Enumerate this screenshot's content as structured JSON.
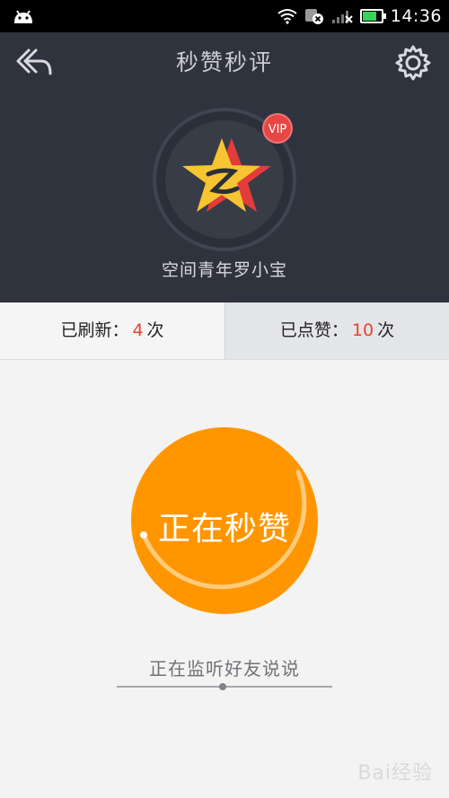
{
  "status_bar": {
    "time": "14:36",
    "icons": [
      "android-icon",
      "wifi-icon",
      "sim-icon",
      "signal-icon",
      "battery-icon"
    ],
    "battery_color": "#36d35a"
  },
  "header": {
    "title": "秒赞秒评",
    "back_icon": "back-arrow-icon",
    "settings_icon": "gear-icon",
    "vip_label": "VIP",
    "username": "空间青年罗小宝"
  },
  "stats": {
    "refreshed": {
      "label": "已刷新：",
      "count": "4",
      "unit": "次"
    },
    "liked": {
      "label": "已点赞：",
      "count": "10",
      "unit": "次"
    }
  },
  "action": {
    "button_label": "正在秒赞",
    "status": "正在监听好友说说"
  },
  "watermark": "Bai经验",
  "colors": {
    "header_bg": "#2f333e",
    "accent_orange": "#ff9600",
    "count_red": "#e8432f",
    "vip_red": "#e84545",
    "star_yellow": "#f7c531",
    "star_red": "#e43b3b"
  }
}
